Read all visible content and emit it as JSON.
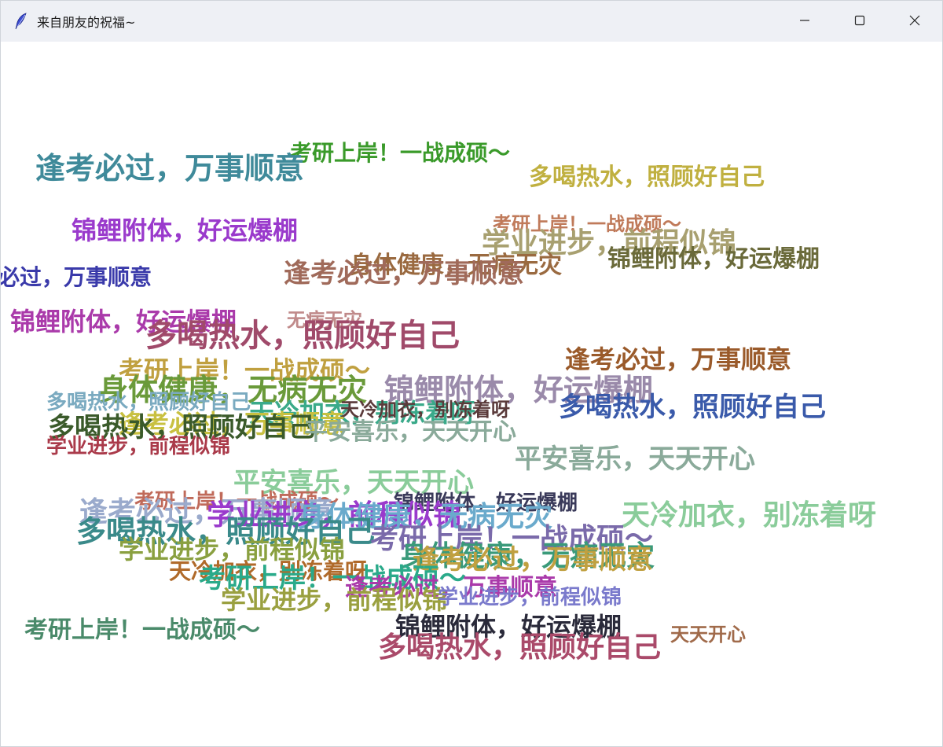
{
  "window": {
    "title": "来自朋友的祝福~",
    "icon": "feather-icon",
    "controls": [
      "minimize-icon",
      "maximize-icon",
      "close-icon"
    ]
  },
  "messages": [
    {
      "text": "考研上岸！一战成硕～",
      "color": "#3a9a2a"
    },
    {
      "text": "逢考必过，万事顺意",
      "color": "#3f8a9a"
    },
    {
      "text": "多喝热水，照顾好自己",
      "color": "#c0b040"
    },
    {
      "text": "锦鲤附体，好运爆棚",
      "color": "#9a3acc"
    },
    {
      "text": "考研上岸！一战成硕～",
      "color": "#c07a5a"
    },
    {
      "text": "学业进步，前程似锦",
      "color": "#a8a070"
    },
    {
      "text": "锦鲤附体，好运爆棚",
      "color": "#6a6a3a"
    },
    {
      "text": "身体健康，无病无灾",
      "color": "#9a6a40"
    },
    {
      "text": "逢考必过，万事顺意",
      "color": "#a06a5a"
    },
    {
      "text": "逢考必过，万事顺意",
      "color": "#3a3aaa"
    },
    {
      "text": "锦鲤附体，好运爆棚",
      "color": "#aa3aaa"
    },
    {
      "text": "无病无灾",
      "color": "#c08a8a"
    },
    {
      "text": "多喝热水，照顾好自己",
      "color": "#a04a6a"
    },
    {
      "text": "逢考必过，万事顺意",
      "color": "#9a5a2a"
    },
    {
      "text": "考研上岸！一战成硕～",
      "color": "#c0a040"
    },
    {
      "text": "身体健康，无病无灾",
      "color": "#6a9a3a"
    },
    {
      "text": "锦鲤附体，好运爆棚",
      "color": "#9a8aaa"
    },
    {
      "text": "多喝热水，照顾好自己",
      "color": "#7aaac0"
    },
    {
      "text": "天冷加衣，别冻着呀",
      "color": "#3aaa8a"
    },
    {
      "text": "多喝热水，照顾好自己",
      "color": "#3a5aaa"
    },
    {
      "text": "天冷加衣，别冻着呀",
      "color": "#5a3a3a"
    },
    {
      "text": "逢考必过，万事顺意",
      "color": "#c8c040"
    },
    {
      "text": "多喝热水，照顾好自己",
      "color": "#3a5a2a"
    },
    {
      "text": "平安喜乐，天天开心",
      "color": "#8aaa9a"
    },
    {
      "text": "学业进步，前程似锦",
      "color": "#aa3a4a"
    },
    {
      "text": "平安喜乐，天天开心",
      "color": "#8aaa9a"
    },
    {
      "text": "平安喜乐，天天开心",
      "color": "#8acc9a"
    },
    {
      "text": "考研上岸！一战成硕～",
      "color": "#c06a5a"
    },
    {
      "text": "锦鲤附体，好运爆棚",
      "color": "#3a3a5a"
    },
    {
      "text": "逢考必过，万事顺意",
      "color": "#9aaacc"
    },
    {
      "text": "学业进步，前程似锦",
      "color": "#9a3acc"
    },
    {
      "text": "身体健康，无病无灾",
      "color": "#6aaacc"
    },
    {
      "text": "天冷加衣，别冻着呀",
      "color": "#8acc9a"
    },
    {
      "text": "多喝热水，照顾好自己",
      "color": "#3a8a8a"
    },
    {
      "text": "考研上岸！一战成硕～",
      "color": "#7a6aaa"
    },
    {
      "text": "学业进步，前程似锦",
      "color": "#8aa040"
    },
    {
      "text": "身体健康，无病无灾",
      "color": "#3a9a7a"
    },
    {
      "text": "逢考必过，万事顺意",
      "color": "#c0a040"
    },
    {
      "text": "天冷加衣，别冻着呀",
      "color": "#b06a2a"
    },
    {
      "text": "考研上岸！一战成硕～",
      "color": "#2aaa8a"
    },
    {
      "text": "逢考必过，万事顺意",
      "color": "#aa3aaa"
    },
    {
      "text": "学业进步，前程似锦",
      "color": "#9aa040"
    },
    {
      "text": "学业进步，前程似锦",
      "color": "#7a7acc"
    },
    {
      "text": "考研上岸！一战成硕～",
      "color": "#4a8a6a"
    },
    {
      "text": "锦鲤附体，好运爆棚",
      "color": "#2a2a3a"
    },
    {
      "text": "多喝热水，照顾好自己",
      "color": "#aa4a6a"
    },
    {
      "text": "天天开心",
      "color": "#a06a4a"
    }
  ]
}
